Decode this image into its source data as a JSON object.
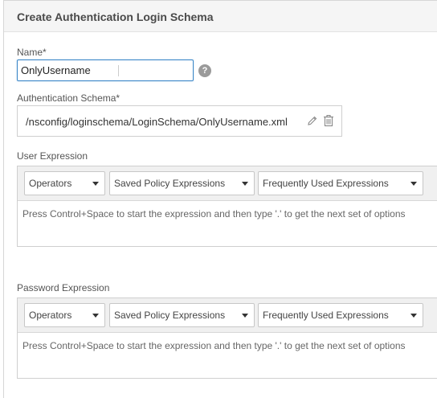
{
  "header": {
    "title": "Create Authentication Login Schema"
  },
  "name": {
    "label": "Name*",
    "value": "OnlyUsername",
    "help_icon": "?"
  },
  "schema": {
    "label": "Authentication Schema*",
    "path": "/nsconfig/loginschema/LoginSchema/OnlyUsername.xml"
  },
  "user_expression": {
    "label": "User Expression",
    "operators": "Operators",
    "saved": "Saved Policy Expressions",
    "frequent": "Frequently Used Expressions",
    "hint": "Press Control+Space to start the expression and then type '.' to get the next set of options"
  },
  "password_expression": {
    "label": "Password Expression",
    "operators": "Operators",
    "saved": "Saved Policy Expressions",
    "frequent": "Frequently Used Expressions",
    "hint": "Press Control+Space to start the expression and then type '.' to get the next set of options"
  }
}
